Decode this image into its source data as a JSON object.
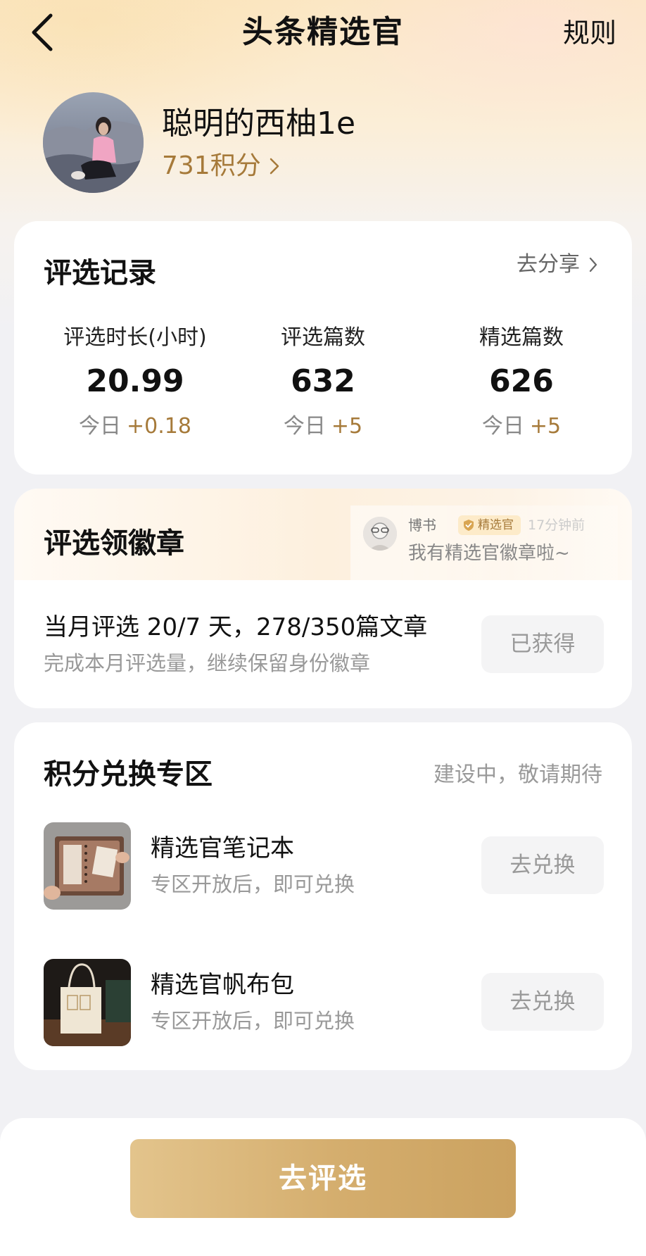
{
  "header": {
    "title": "头条精选官",
    "rules_label": "规则"
  },
  "profile": {
    "username": "聪明的西柚1e",
    "points": "731积分"
  },
  "record": {
    "title": "评选记录",
    "share_label": "去分享",
    "today_label": "今日",
    "stats": [
      {
        "label": "评选时长(小时)",
        "value": "20.99",
        "delta": "+0.18"
      },
      {
        "label": "评选篇数",
        "value": "632",
        "delta": "+5"
      },
      {
        "label": "精选篇数",
        "value": "626",
        "delta": "+5"
      }
    ]
  },
  "badge": {
    "title": "评选领徽章",
    "ticker": {
      "user": "博书",
      "badge_label": "精选官",
      "time": "17分钟前",
      "message": "我有精选官徽章啦~"
    },
    "progress_text": "当月评选 20/7 天，278/350篇文章",
    "hint": "完成本月评选量，继续保留身份徽章",
    "button_label": "已获得"
  },
  "exchange": {
    "title": "积分兑换专区",
    "status": "建设中，敬请期待",
    "items": [
      {
        "name": "精选官笔记本",
        "desc": "专区开放后，即可兑换",
        "button_label": "去兑换",
        "icon": "notebook-image"
      },
      {
        "name": "精选官帆布包",
        "desc": "专区开放后，即可兑换",
        "button_label": "去兑换",
        "icon": "tote-bag-image"
      }
    ]
  },
  "cta": {
    "label": "去评选"
  },
  "colors": {
    "accent": "#a67a3a",
    "button_gradient_start": "#e3c48c",
    "button_gradient_end": "#cba260",
    "muted_button_bg": "#f4f4f5"
  }
}
